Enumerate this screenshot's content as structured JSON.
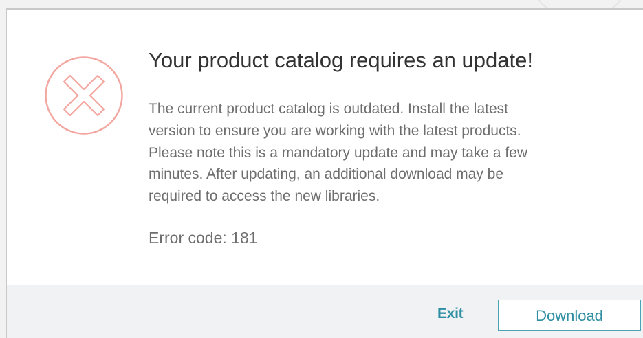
{
  "dialog": {
    "title": "Your product catalog requires an update!",
    "message_lines": [
      "The current product catalog is outdated. Install the latest",
      "version to ensure you are working with the latest products.",
      "Please note this is a mandatory update and may take a few",
      "minutes. After updating, an additional download may be",
      "required to access the new libraries."
    ],
    "error_code": "Error code: 181",
    "icon": "error-x-circle-icon"
  },
  "actions": {
    "exit_label": "Exit",
    "download_label": "Download"
  },
  "colors": {
    "accent": "#2e8fa3",
    "error_icon": "#f4a6a0",
    "footer_bg": "#f0f2f4",
    "body_text": "#6e6e6e",
    "title_text": "#333333"
  }
}
